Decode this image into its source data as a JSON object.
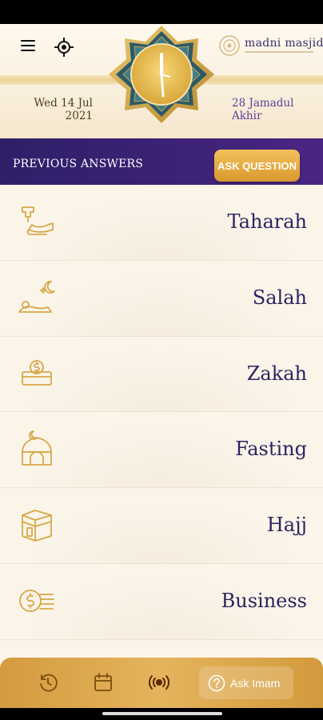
{
  "header": {
    "logo_text": "madni masjid",
    "date_gregorian_line1": "Wed 14 Jul",
    "date_gregorian_line2": "2021",
    "date_hijri_line1": "28 Jamadul",
    "date_hijri_line2": "Akhir"
  },
  "toolbar": {
    "previous_answers_label": "PREVIOUS ANSWERS",
    "ask_question_label": "ASK QUESTION"
  },
  "categories": [
    {
      "label": "Taharah",
      "icon": "ablution-tap-icon"
    },
    {
      "label": "Salah",
      "icon": "prayer-icon"
    },
    {
      "label": "Zakah",
      "icon": "charity-coin-icon"
    },
    {
      "label": "Fasting",
      "icon": "mosque-crescent-icon"
    },
    {
      "label": "Hajj",
      "icon": "kaaba-icon"
    },
    {
      "label": "Business",
      "icon": "coins-icon"
    }
  ],
  "bottom_nav": {
    "ask_imam_label": "Ask Imam",
    "items": [
      "history-icon",
      "calendar-icon",
      "broadcast-icon",
      "help-circle-icon"
    ]
  },
  "colors": {
    "purple": "#2e1f69",
    "gold": "#d9982f",
    "text": "#2c2461",
    "background": "#fbf4e9"
  }
}
